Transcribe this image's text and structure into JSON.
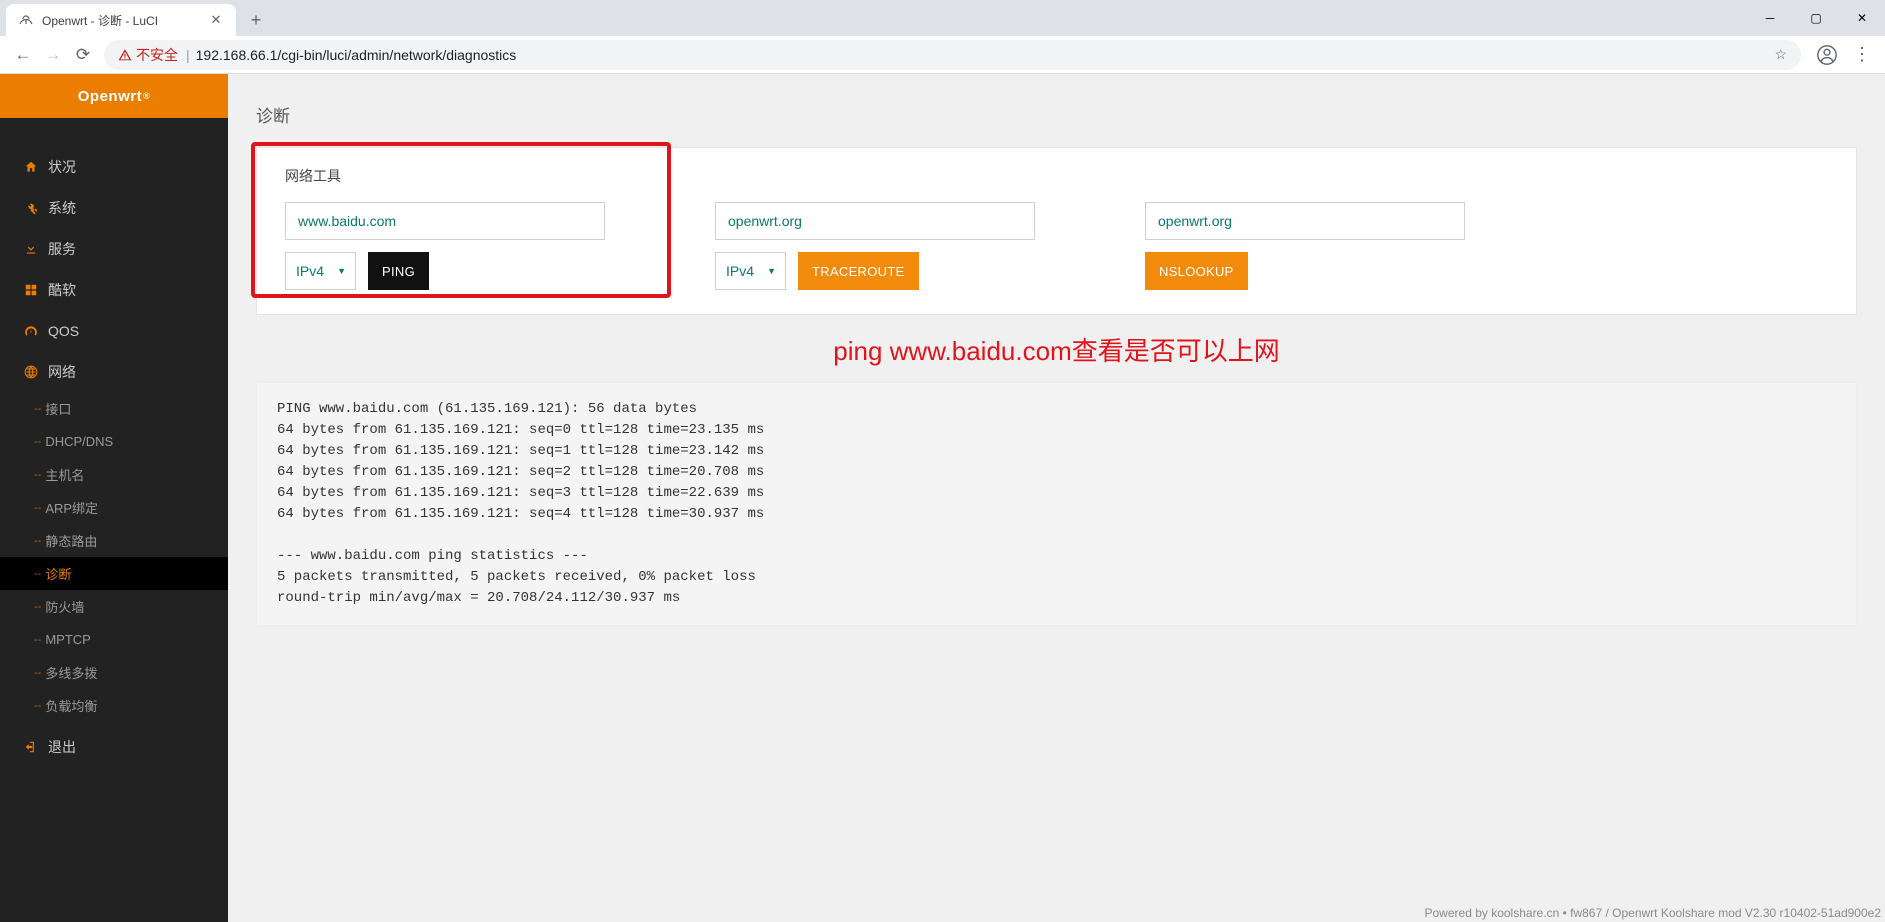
{
  "browser": {
    "tab_title": "Openwrt - 诊断 - LuCI",
    "insecure_label": "不安全",
    "url": "192.168.66.1/cgi-bin/luci/admin/network/diagnostics"
  },
  "brand": "Openwrt",
  "sidebar": {
    "items": [
      {
        "label": "状况"
      },
      {
        "label": "系统"
      },
      {
        "label": "服务"
      },
      {
        "label": "酷软"
      },
      {
        "label": "QOS"
      },
      {
        "label": "网络"
      }
    ],
    "network_subitems": [
      {
        "label": "接口"
      },
      {
        "label": "DHCP/DNS"
      },
      {
        "label": "主机名"
      },
      {
        "label": "ARP绑定"
      },
      {
        "label": "静态路由"
      },
      {
        "label": "诊断",
        "active": true
      },
      {
        "label": "防火墙"
      },
      {
        "label": "MPTCP"
      },
      {
        "label": "多线多拨"
      },
      {
        "label": "负载均衡"
      }
    ],
    "logout": "退出"
  },
  "page": {
    "title": "诊断",
    "section_title": "网络工具",
    "ping": {
      "host": "www.baidu.com",
      "proto": "IPv4",
      "button": "PING"
    },
    "traceroute": {
      "host": "openwrt.org",
      "proto": "IPv4",
      "button": "TRACEROUTE"
    },
    "nslookup": {
      "host": "openwrt.org",
      "button": "NSLOOKUP"
    },
    "annotation": "ping www.baidu.com查看是否可以上网",
    "output": "PING www.baidu.com (61.135.169.121): 56 data bytes\n64 bytes from 61.135.169.121: seq=0 ttl=128 time=23.135 ms\n64 bytes from 61.135.169.121: seq=1 ttl=128 time=23.142 ms\n64 bytes from 61.135.169.121: seq=2 ttl=128 time=20.708 ms\n64 bytes from 61.135.169.121: seq=3 ttl=128 time=22.639 ms\n64 bytes from 61.135.169.121: seq=4 ttl=128 time=30.937 ms\n\n--- www.baidu.com ping statistics ---\n5 packets transmitted, 5 packets received, 0% packet loss\nround-trip min/avg/max = 20.708/24.112/30.937 ms",
    "footer": "Powered by koolshare.cn • fw867 / Openwrt Koolshare mod V2.30 r10402-51ad900e2"
  }
}
